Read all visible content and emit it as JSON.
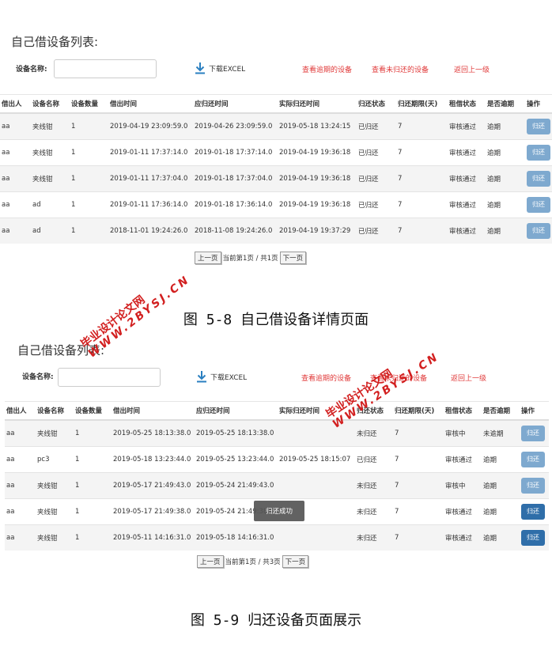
{
  "headers": [
    "借出人",
    "设备名称",
    "设备数量",
    "借出时间",
    "应归还时间",
    "实际归还时间",
    "归还状态",
    "归还期限(天)",
    "租借状态",
    "是否逾期",
    "操作"
  ],
  "panel1": {
    "title": "自己借设备列表:",
    "search_label": "设备名称:",
    "search_value": "",
    "download_label": "下载EXCEL",
    "links": [
      "查看逾期的设备",
      "查看未归还的设备",
      "返回上一级"
    ],
    "rows": [
      [
        "aa",
        "夹线钳",
        "1",
        "2019-04-19 23:09:59.0",
        "2019-04-26 23:09:59.0",
        "2019-05-18 13:24:15",
        "已归还",
        "7",
        "审核通过",
        "逾期",
        "归还"
      ],
      [
        "aa",
        "夹线钳",
        "1",
        "2019-01-11 17:37:14.0",
        "2019-01-18 17:37:14.0",
        "2019-04-19 19:36:18",
        "已归还",
        "7",
        "审核通过",
        "逾期",
        "归还"
      ],
      [
        "aa",
        "夹线钳",
        "1",
        "2019-01-11 17:37:04.0",
        "2019-01-18 17:37:04.0",
        "2019-04-19 19:36:18",
        "已归还",
        "7",
        "审核通过",
        "逾期",
        "归还"
      ],
      [
        "aa",
        "ad",
        "1",
        "2019-01-11 17:36:14.0",
        "2019-01-18 17:36:14.0",
        "2019-04-19 19:36:18",
        "已归还",
        "7",
        "审核通过",
        "逾期",
        "归还"
      ],
      [
        "aa",
        "ad",
        "1",
        "2018-11-01 19:24:26.0",
        "2018-11-08 19:24:26.0",
        "2019-04-19 19:37:29",
        "已归还",
        "7",
        "审核通过",
        "逾期",
        "归还"
      ]
    ],
    "pager": {
      "prev": "上一页",
      "status": "当前第1页 / 共1页",
      "next": "下一页"
    }
  },
  "caption1": "图 5-8 自己借设备详情页面",
  "panel2": {
    "title": "自己借设备列表:",
    "search_label": "设备名称:",
    "search_value": "",
    "download_label": "下载EXCEL",
    "links": [
      "查看逾期的设备",
      "查看未归还的设备",
      "返回上一级"
    ],
    "rows": [
      [
        "aa",
        "夹线钳",
        "1",
        "2019-05-25 18:13:38.0",
        "2019-05-25 18:13:38.0",
        "",
        "未归还",
        "7",
        "审核中",
        "未逾期",
        "归还"
      ],
      [
        "aa",
        "pc3",
        "1",
        "2019-05-18 13:23:44.0",
        "2019-05-25 13:23:44.0",
        "2019-05-25 18:15:07",
        "已归还",
        "7",
        "审核通过",
        "逾期",
        "归还"
      ],
      [
        "aa",
        "夹线钳",
        "1",
        "2019-05-17 21:49:43.0",
        "2019-05-24 21:49:43.0",
        "",
        "未归还",
        "7",
        "审核中",
        "逾期",
        "归还"
      ],
      [
        "aa",
        "夹线钳",
        "1",
        "2019-05-17 21:49:38.0",
        "2019-05-24 21:49:38.0",
        "",
        "未归还",
        "7",
        "审核通过",
        "逾期",
        "归还"
      ],
      [
        "aa",
        "夹线钳",
        "1",
        "2019-05-11 14:16:31.0",
        "2019-05-18 14:16:31.0",
        "",
        "未归还",
        "7",
        "审核通过",
        "逾期",
        "归还"
      ]
    ],
    "active_rows": [
      3,
      4
    ],
    "toast": "归还成功",
    "pager": {
      "prev": "上一页",
      "status": "当前第1页 / 共3页",
      "next": "下一页"
    }
  },
  "caption2": "图 5-9 归还设备页面展示",
  "watermark": {
    "cn": "毕业设计论文网",
    "url": "WWW.2BYSJ.CN",
    "color": "#d21f1f"
  },
  "colors": {
    "link": "#e03a3a",
    "button": "#7ea9cf",
    "button_active": "#2f6ea9"
  }
}
